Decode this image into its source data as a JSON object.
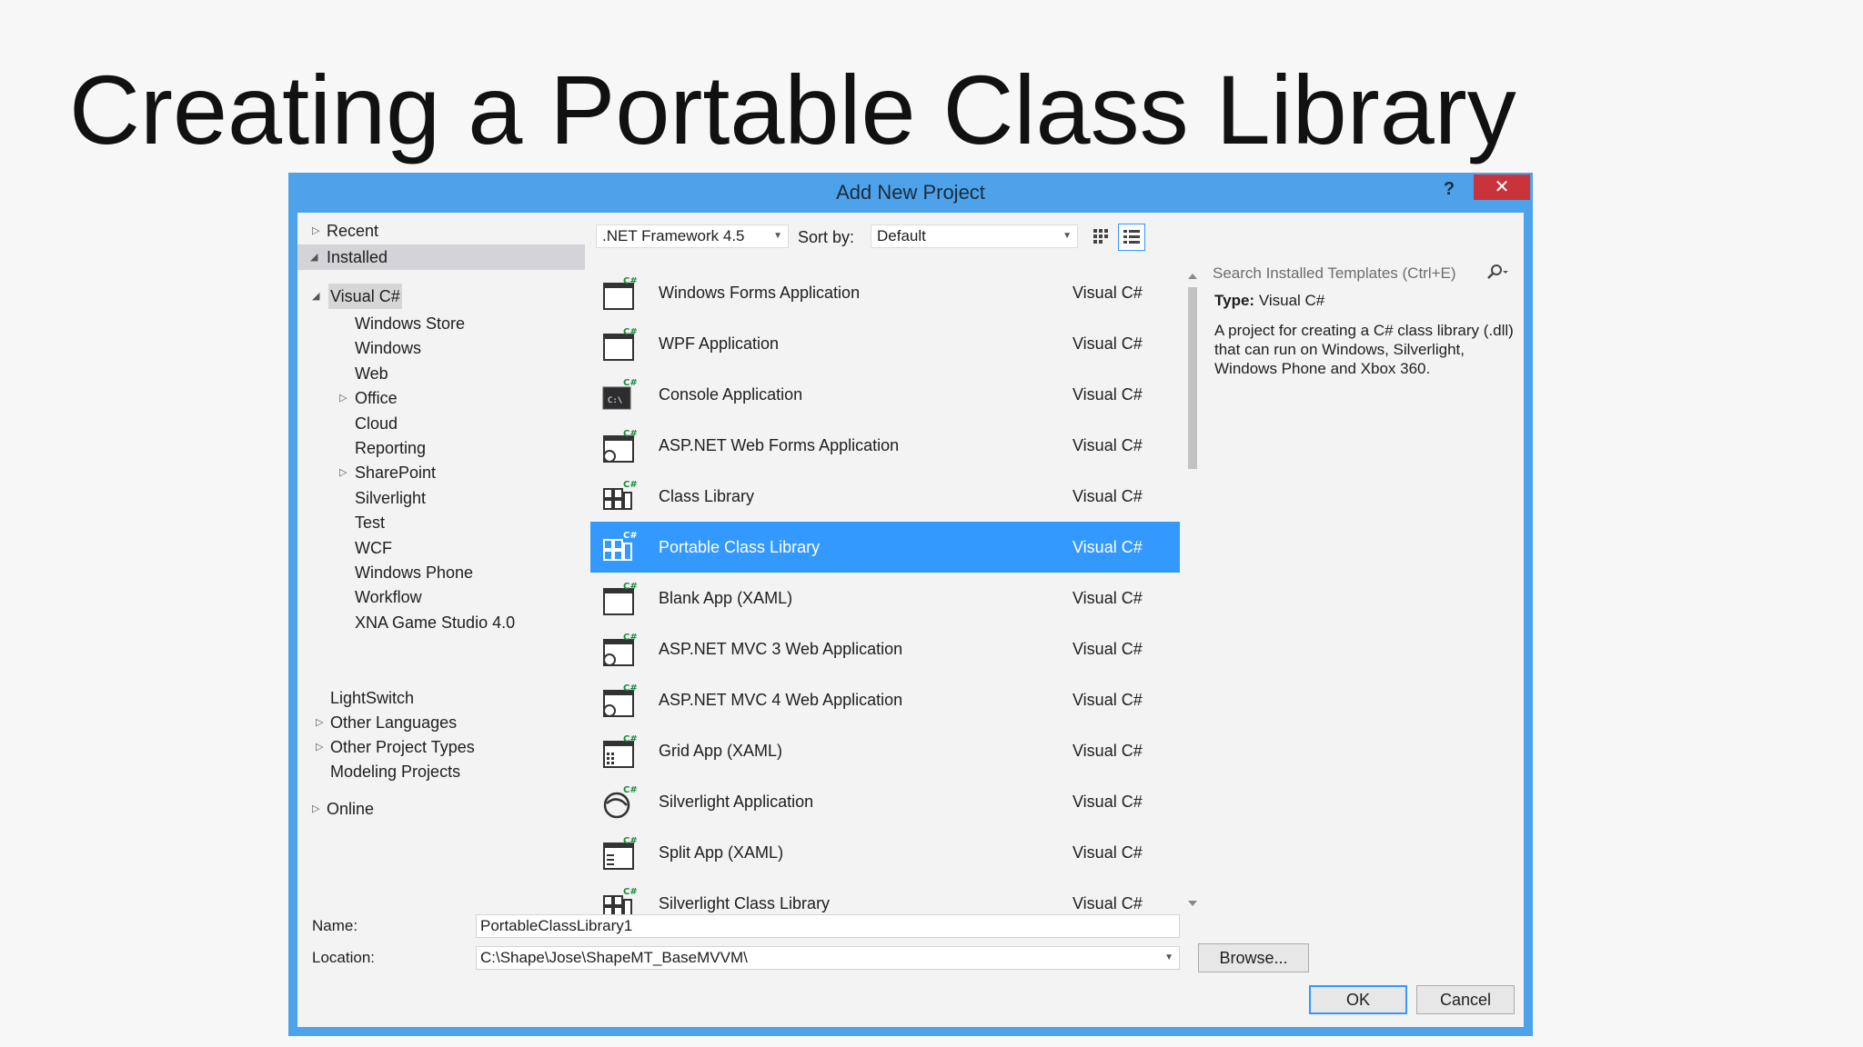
{
  "slide": {
    "title": "Creating a Portable Class Library"
  },
  "dialog": {
    "title": "Add New Project",
    "help_label": "?",
    "close_label": "✕"
  },
  "tree": {
    "recent": "Recent",
    "installed": "Installed",
    "visual_csharp": "Visual C#",
    "children": [
      "Windows Store",
      "Windows",
      "Web",
      "Office",
      "Cloud",
      "Reporting",
      "SharePoint",
      "Silverlight",
      "Test",
      "WCF",
      "Windows Phone",
      "Workflow",
      "XNA Game Studio 4.0"
    ],
    "lightswitch": "LightSwitch",
    "other_languages": "Other Languages",
    "other_project_types": "Other Project Types",
    "modeling_projects": "Modeling Projects",
    "online": "Online"
  },
  "toolbar": {
    "framework": ".NET Framework 4.5",
    "sort_label": "Sort by:",
    "sort_value": "Default"
  },
  "search": {
    "placeholder": "Search Installed Templates (Ctrl+E)"
  },
  "templates": [
    {
      "name": "Windows Forms Application",
      "lang": "Visual C#"
    },
    {
      "name": "WPF Application",
      "lang": "Visual C#"
    },
    {
      "name": "Console Application",
      "lang": "Visual C#"
    },
    {
      "name": "ASP.NET Web Forms Application",
      "lang": "Visual C#"
    },
    {
      "name": "Class Library",
      "lang": "Visual C#"
    },
    {
      "name": "Portable Class Library",
      "lang": "Visual C#"
    },
    {
      "name": "Blank App (XAML)",
      "lang": "Visual C#"
    },
    {
      "name": "ASP.NET MVC 3 Web Application",
      "lang": "Visual C#"
    },
    {
      "name": "ASP.NET MVC 4 Web Application",
      "lang": "Visual C#"
    },
    {
      "name": "Grid App (XAML)",
      "lang": "Visual C#"
    },
    {
      "name": "Silverlight Application",
      "lang": "Visual C#"
    },
    {
      "name": "Split App (XAML)",
      "lang": "Visual C#"
    },
    {
      "name": "Silverlight Class Library",
      "lang": "Visual C#"
    }
  ],
  "description": {
    "type_label": "Type:",
    "type_value": "Visual C#",
    "text": "A project for creating a C# class library (.dll) that can run on Windows, Silverlight, Windows Phone and Xbox 360."
  },
  "form": {
    "name_label": "Name:",
    "name_value": "PortableClassLibrary1",
    "location_label": "Location:",
    "location_value": "C:\\Shape\\Jose\\ShapeMT_BaseMVVM\\",
    "browse_label": "Browse...",
    "ok_label": "OK",
    "cancel_label": "Cancel"
  },
  "colors": {
    "accent": "#3399ff",
    "titlebar": "#4ea2ea",
    "close": "#c9343a"
  }
}
